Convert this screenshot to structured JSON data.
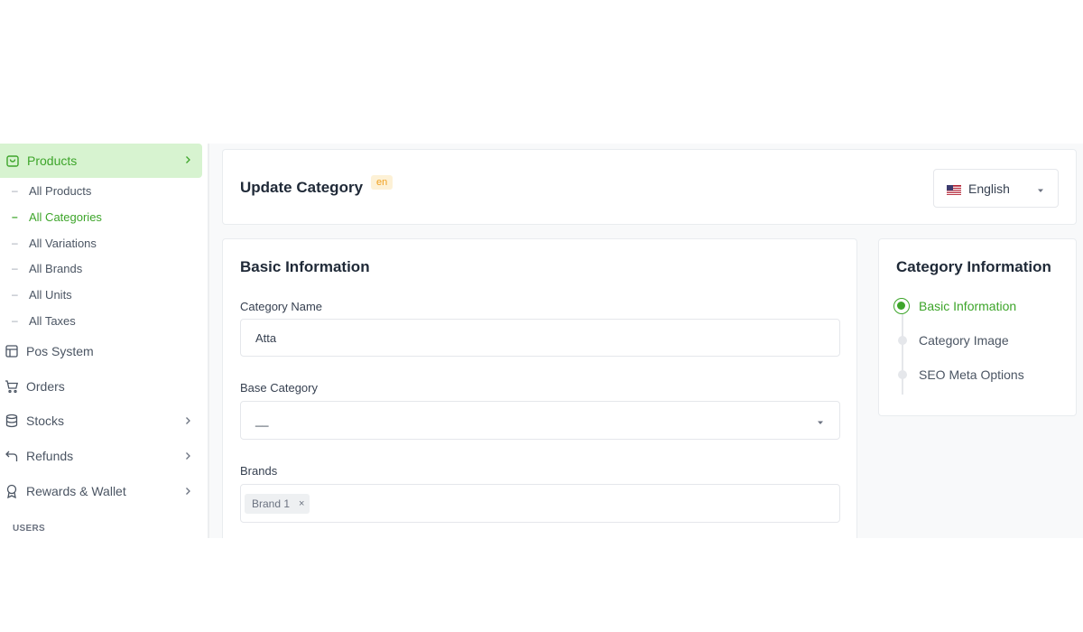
{
  "sidebar": {
    "active": {
      "label": "Products",
      "icon": "shopping-bag-icon"
    },
    "sub_items": [
      {
        "label": "All Products",
        "active": false
      },
      {
        "label": "All Categories",
        "active": true
      },
      {
        "label": "All Variations",
        "active": false
      },
      {
        "label": "All Brands",
        "active": false
      },
      {
        "label": "All Units",
        "active": false
      },
      {
        "label": "All Taxes",
        "active": false
      }
    ],
    "items": [
      {
        "label": "Pos System",
        "icon": "layout-icon"
      },
      {
        "label": "Orders",
        "icon": "cart-icon"
      },
      {
        "label": "Stocks",
        "icon": "database-icon"
      },
      {
        "label": "Refunds",
        "icon": "undo-icon"
      },
      {
        "label": "Rewards & Wallet",
        "icon": "award-icon"
      }
    ],
    "section_label": "USERS"
  },
  "header": {
    "title": "Update Category",
    "lang_badge": "en",
    "language": "English"
  },
  "basic": {
    "title": "Basic Information",
    "category_name_label": "Category Name",
    "category_name_value": "Atta",
    "base_category_label": "Base Category",
    "base_category_value": "__",
    "brands_label": "Brands",
    "brand_tag": "Brand 1",
    "brand_tag_remove": "×"
  },
  "info": {
    "title": "Category Information",
    "steps": [
      "Basic Information",
      "Category Image",
      "SEO Meta Options"
    ]
  },
  "colors": {
    "accent": "#3da52a",
    "accent_bg": "#d7f3d0",
    "badge_bg": "#fdf1d6",
    "badge_text": "#f0a020"
  }
}
